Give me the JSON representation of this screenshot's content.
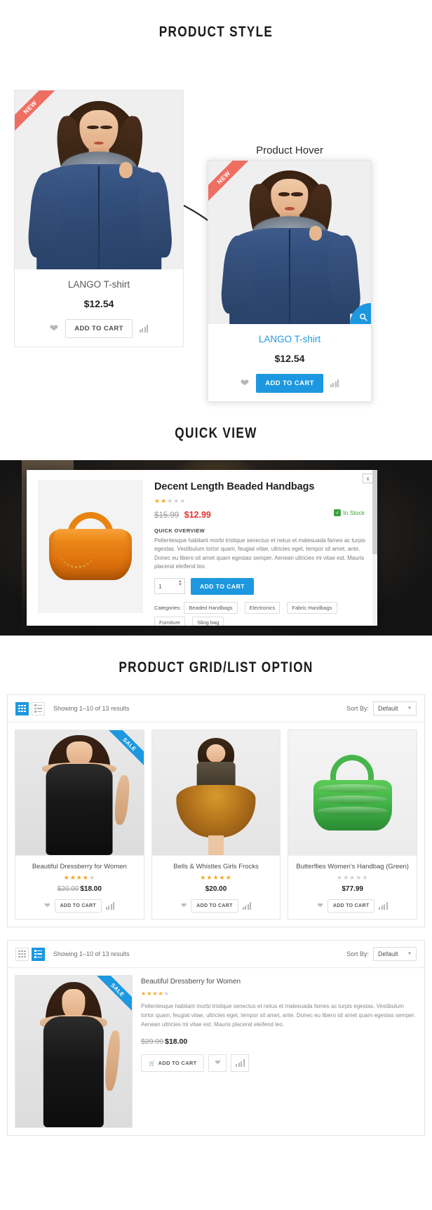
{
  "sections": {
    "style_title": "PRODUCT STYLE",
    "quick_title": "QUICK VIEW",
    "grid_title": "PRODUCT GRID/LIST OPTION"
  },
  "product_style": {
    "hover_label": "Product Hover",
    "badge_new": "NEW",
    "card": {
      "title": "LANGO T-shirt",
      "price": "$12.54",
      "add_to_cart": "ADD TO CART"
    },
    "card_hover": {
      "title": "LANGO T-shirt",
      "price": "$12.54",
      "add_to_cart": "ADD TO CART"
    },
    "accent_color": "#1d98e0",
    "ribbon_color": "#ef6e62"
  },
  "quick_view": {
    "close_label": "x",
    "title": "Decent Length Beaded Handbags",
    "rating": 2,
    "rating_max": 5,
    "price_old": "$15.99",
    "price_new": "$12.99",
    "stock": "In Stock",
    "overview_label": "QUICK OVERVIEW",
    "description": "Pellentesque habitant morbi tristique senectus et netus et malesuada fames ac turpis egestas. Vestibulum tortor quam, feugiat vitae, ultricies eget, tempor sit amet, ante. Donec eu libero sit amet quam egestas semper. Aenean ultricies mi vitae est. Mauris placerat eleifend leo.",
    "qty_value": "1",
    "add_to_cart": "ADD TO CART",
    "categories_label": "Categories:",
    "categories": [
      "Beaded Handbags",
      "Electronics",
      "Fabric Handbags",
      "Furniture",
      "Sling bag"
    ]
  },
  "grid_list": {
    "toolbar": {
      "showing": "Showing 1–10 of 13 results",
      "sort_label": "Sort By:",
      "sort_value": "Default"
    },
    "grid_products": [
      {
        "name": "Beautiful Dressberry for Women",
        "rating": 4,
        "price_old": "$20.00",
        "price": "$18.00",
        "badge": "SALE",
        "add_to_cart": "ADD TO CART"
      },
      {
        "name": "Bells & Whistles Girls Frocks",
        "rating": 5,
        "price_old": "",
        "price": "$20.00",
        "badge": "",
        "add_to_cart": "ADD TO CART"
      },
      {
        "name": "Butterflies Women's Handbag (Green)",
        "rating": 0,
        "price_old": "",
        "price": "$77.99",
        "badge": "",
        "add_to_cart": "ADD TO CART"
      }
    ],
    "list_product": {
      "name": "Beautiful Dressberry for Women",
      "rating": 4,
      "badge": "SALE",
      "description": "Pellentesque habitant morbi tristique senectus et netus et malesuada fames ac turpis egestas. Vestibulum tortor quam, feugiat vitae, ultricies eget, tempor sit amet, ante. Donec eu libero sit amet quam egestas semper. Aenean ultricies mi vitae est. Mauris placerat eleifend leo.",
      "price_old": "$20.00",
      "price": "$18.00",
      "add_to_cart": "ADD TO CART"
    }
  }
}
